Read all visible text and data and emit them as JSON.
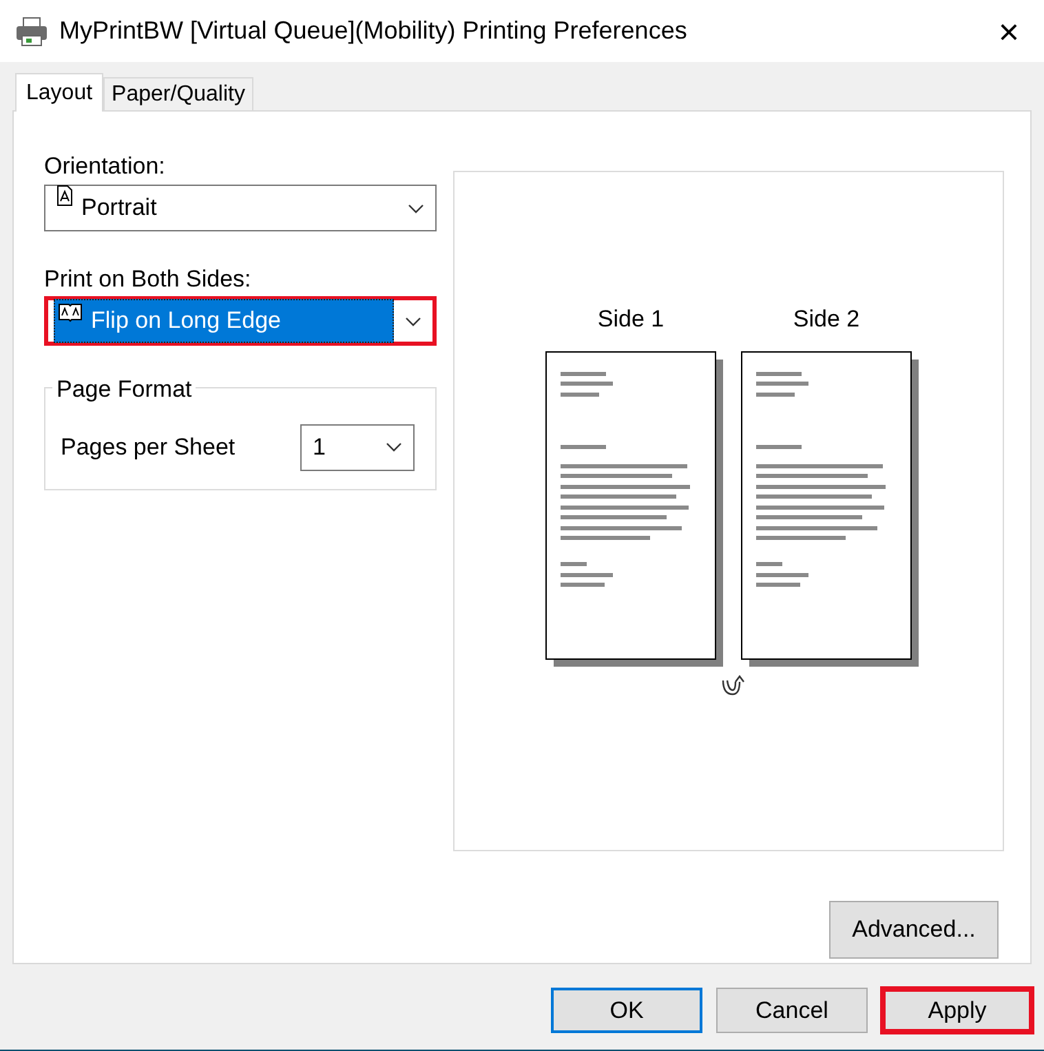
{
  "window": {
    "title": "MyPrintBW [Virtual Queue](Mobility) Printing Preferences",
    "close": "×"
  },
  "tabs": [
    {
      "label": "Layout",
      "selected": true
    },
    {
      "label": "Paper/Quality",
      "selected": false
    }
  ],
  "orientation": {
    "label": "Orientation:",
    "value": "Portrait",
    "focused": false,
    "highlighted": false
  },
  "duplex": {
    "label": "Print on Both Sides:",
    "value": "Flip on Long Edge",
    "focused": true,
    "highlighted": true
  },
  "page_format": {
    "title": "Page Format",
    "pages_per_sheet": {
      "label": "Pages per Sheet",
      "value": "1"
    }
  },
  "preview": {
    "sides": [
      "Side 1",
      "Side 2"
    ]
  },
  "advanced_button": "Advanced...",
  "buttons": [
    {
      "label": "OK",
      "default": true,
      "highlighted": false
    },
    {
      "label": "Cancel",
      "default": false,
      "highlighted": false
    },
    {
      "label": "Apply",
      "default": false,
      "highlighted": true
    }
  ]
}
